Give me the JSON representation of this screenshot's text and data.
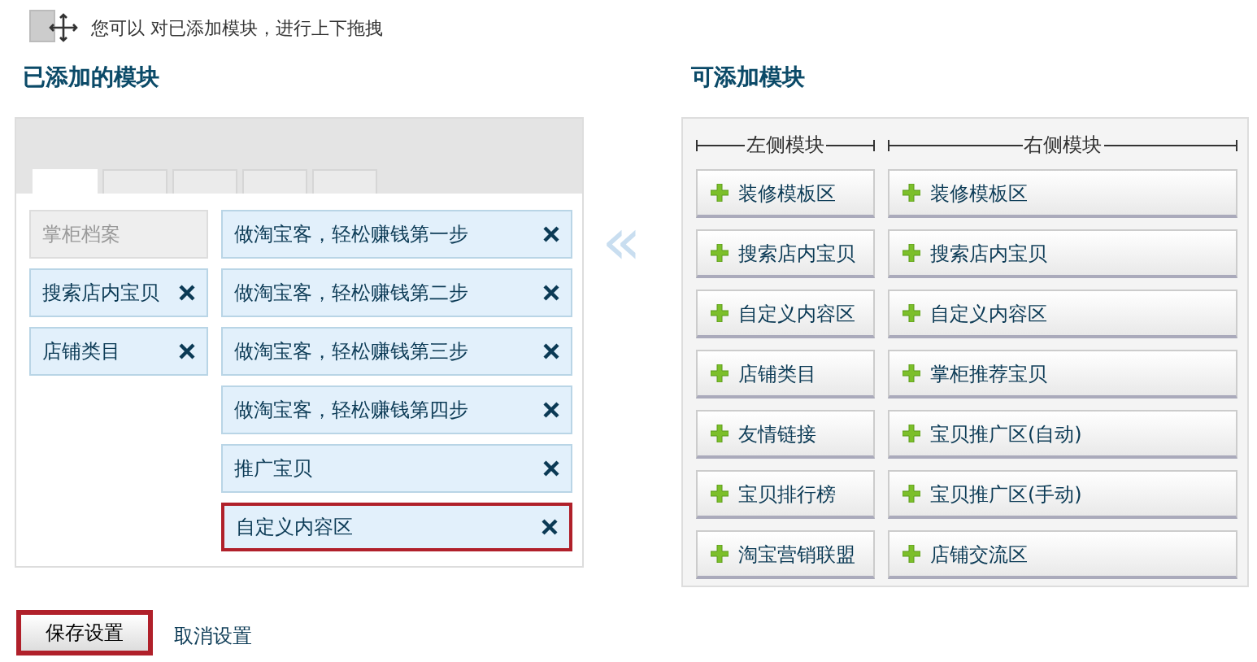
{
  "hint": "您可以 对已添加模块，进行上下拖拽",
  "added": {
    "title": "已添加的模块",
    "tabs": [
      {
        "selected": true
      },
      {
        "selected": false
      },
      {
        "selected": false
      },
      {
        "selected": false
      },
      {
        "selected": false
      }
    ],
    "left_column": [
      {
        "label": "掌柜档案",
        "locked": true,
        "selected": false
      },
      {
        "label": "搜索店内宝贝",
        "locked": false,
        "selected": false
      },
      {
        "label": "店铺类目",
        "locked": false,
        "selected": false
      }
    ],
    "right_column": [
      {
        "label": "做淘宝客，轻松赚钱第一步",
        "locked": false,
        "selected": false
      },
      {
        "label": "做淘宝客，轻松赚钱第二步",
        "locked": false,
        "selected": false
      },
      {
        "label": "做淘宝客，轻松赚钱第三步",
        "locked": false,
        "selected": false
      },
      {
        "label": "做淘宝客，轻松赚钱第四步",
        "locked": false,
        "selected": false
      },
      {
        "label": "推广宝贝",
        "locked": false,
        "selected": false
      },
      {
        "label": "自定义内容区",
        "locked": false,
        "selected": true
      }
    ]
  },
  "move_arrow": "«",
  "available": {
    "title": "可添加模块",
    "left_header": "左侧模块",
    "right_header": "右侧模块",
    "left_column": [
      "装修模板区",
      "搜索店内宝贝",
      "自定义内容区",
      "店铺类目",
      "友情链接",
      "宝贝排行榜",
      "淘宝营销联盟"
    ],
    "right_column": [
      "装修模板区",
      "搜索店内宝贝",
      "自定义内容区",
      "掌柜推荐宝贝",
      "宝贝推广区(自动)",
      "宝贝推广区(手动)",
      "店铺交流区"
    ]
  },
  "save_button": {
    "label": "保存设置",
    "highlighted": true
  },
  "cancel_link": "取消设置"
}
